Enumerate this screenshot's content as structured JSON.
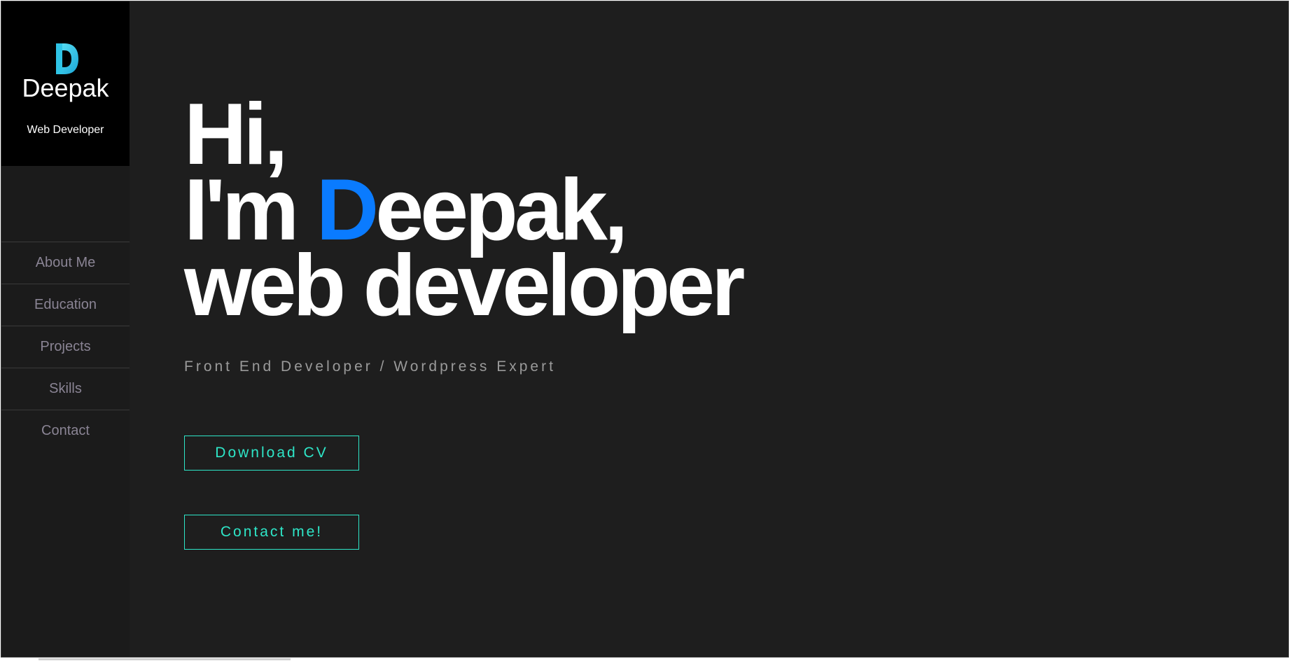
{
  "colors": {
    "background": "#1e1e1e",
    "sidebar": "#1b1b1b",
    "brand_panel": "#000000",
    "accent_blue": "#0a7bff",
    "accent_teal": "#2ee6c8",
    "nav_text": "#8a8494"
  },
  "sidebar": {
    "logo_icon": "d-logo-icon",
    "brand_name": "Deepak",
    "brand_role": "Web Developer",
    "nav": [
      {
        "label": "About Me"
      },
      {
        "label": "Education"
      },
      {
        "label": "Projects"
      },
      {
        "label": "Skills"
      },
      {
        "label": "Contact"
      }
    ]
  },
  "hero": {
    "line1": "Hi,",
    "line2_prefix": "I'm ",
    "line2_accent": "D",
    "line2_rest": "eepak,",
    "line3": "web developer",
    "subtitle": "Front End Developer / Wordpress Expert",
    "download_label": "Download CV",
    "contact_label": "Contact me!"
  }
}
